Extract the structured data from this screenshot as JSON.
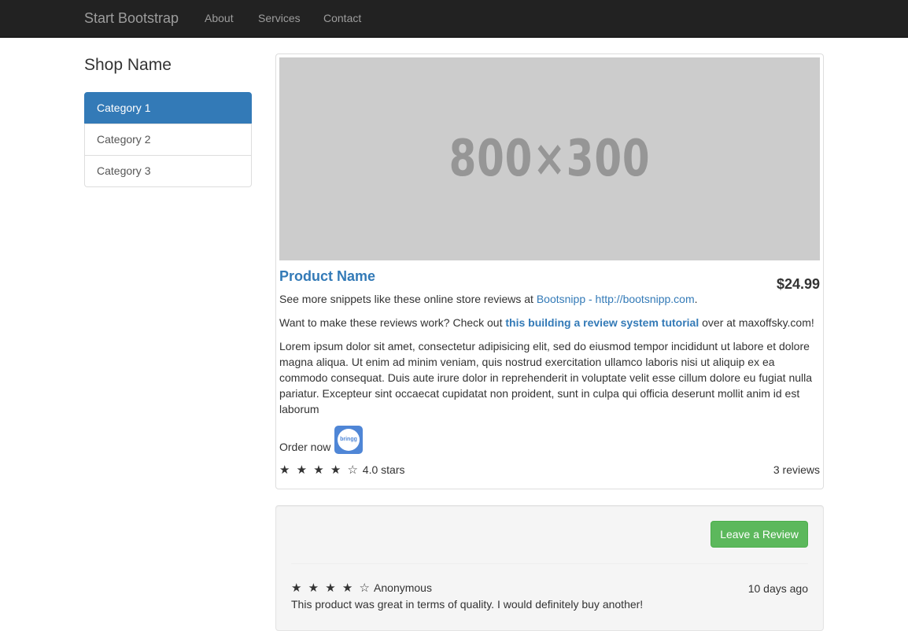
{
  "navbar": {
    "brand": "Start Bootstrap",
    "links": [
      "About",
      "Services",
      "Contact"
    ]
  },
  "sidebar": {
    "shop_name": "Shop Name",
    "categories": [
      {
        "label": "Category 1",
        "active": true
      },
      {
        "label": "Category 2",
        "active": false
      },
      {
        "label": "Category 3",
        "active": false
      }
    ]
  },
  "product": {
    "image_placeholder": "800×300",
    "name": "Product Name",
    "price": "$24.99",
    "snippets": {
      "prefix": "See more snippets like these online store reviews at ",
      "link": "Bootsnipp - http://bootsnipp.com",
      "suffix": "."
    },
    "tutorial": {
      "prefix": "Want to make these reviews work? Check out ",
      "link": "this building a review system tutorial",
      "suffix": " over at maxoffsky.com!"
    },
    "description": "Lorem ipsum dolor sit amet, consectetur adipisicing elit, sed do eiusmod tempor incididunt ut labore et dolore magna aliqua. Ut enim ad minim veniam, quis nostrud exercitation ullamco laboris nisi ut aliquip ex ea commodo consequat. Duis aute irure dolor in reprehenderit in voluptate velit esse cillum dolore eu fugiat nulla pariatur. Excepteur sint occaecat cupidatat non proident, sunt in culpa qui officia deserunt mollit anim id est laborum",
    "order_label": "Order now",
    "order_icon": "bringg-icon",
    "order_icon_text": "bringg",
    "rating": {
      "stars": "★ ★ ★ ★ ☆",
      "value": 4,
      "max": 5,
      "label": "4.0 stars"
    },
    "reviews_count": "3 reviews"
  },
  "reviews": {
    "leave_review_label": "Leave a Review",
    "items": [
      {
        "stars": "★ ★ ★ ★ ☆",
        "rating": 4,
        "author": "Anonymous",
        "time": "10 days ago",
        "text": "This product was great in terms of quality. I would definitely buy another!"
      }
    ]
  },
  "colors": {
    "navbar_bg": "#222222",
    "primary": "#337ab7",
    "success": "#5cb85c",
    "placeholder_bg": "#cccccc"
  }
}
